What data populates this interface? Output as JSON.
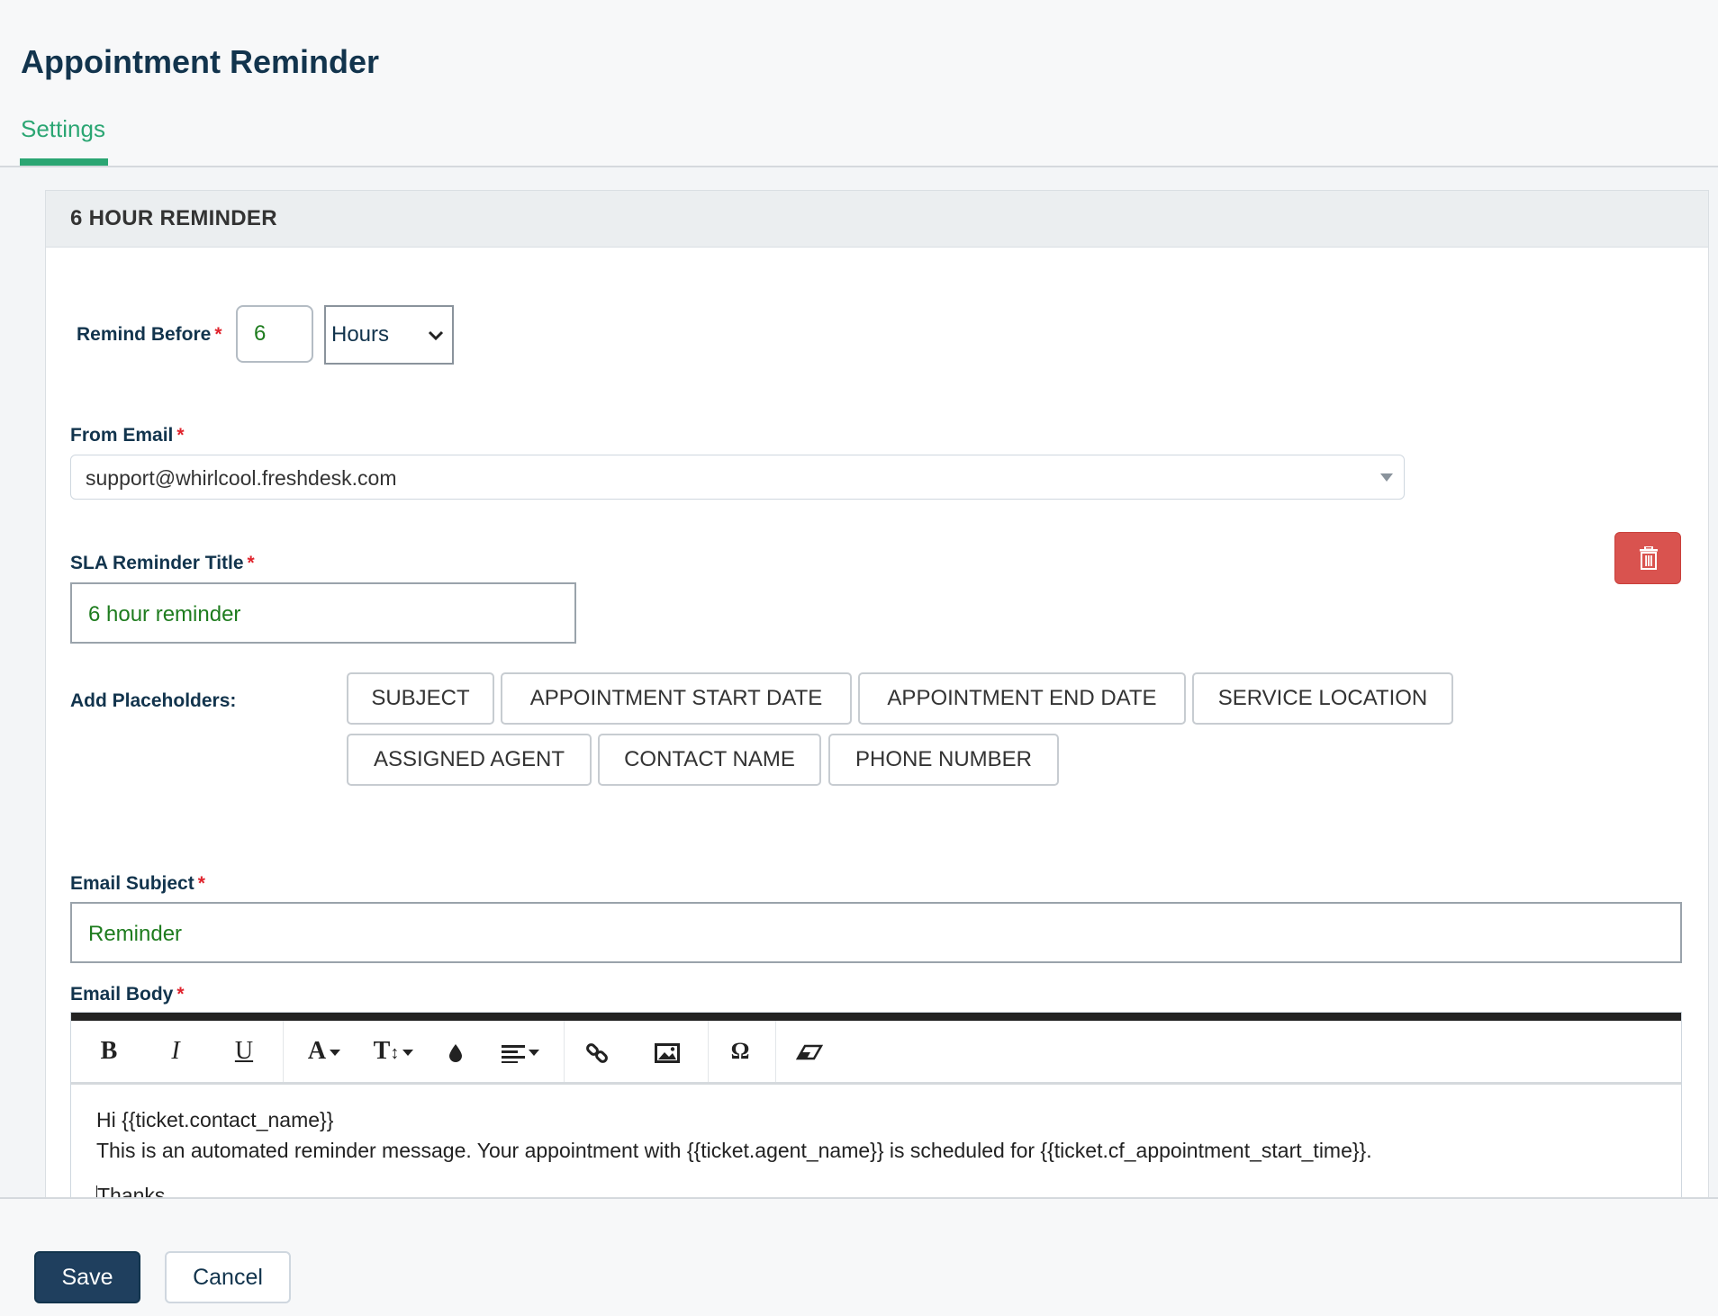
{
  "page": {
    "title": "Appointment Reminder"
  },
  "tabs": [
    {
      "label": "Settings",
      "active": true
    }
  ],
  "panel": {
    "title": "6 HOUR REMINDER"
  },
  "remind_before": {
    "label": "Remind Before",
    "required_mark": "*",
    "value": "6",
    "unit": "Hours"
  },
  "from_email": {
    "label": "From Email",
    "required_mark": "*",
    "value": "support@whirlcool.freshdesk.com"
  },
  "sla_title": {
    "label": "SLA Reminder Title",
    "required_mark": "*",
    "value": "6 hour reminder"
  },
  "placeholders": {
    "label": "Add Placeholders:",
    "buttons": [
      "SUBJECT",
      "APPOINTMENT START DATE",
      "APPOINTMENT END DATE",
      "SERVICE LOCATION",
      "ASSIGNED AGENT",
      "CONTACT NAME",
      "PHONE NUMBER"
    ]
  },
  "email_subject": {
    "label": "Email Subject",
    "required_mark": "*",
    "value": "Reminder"
  },
  "email_body": {
    "label": "Email Body",
    "required_mark": "*",
    "toolbar": [
      "bold",
      "italic",
      "underline",
      "font-family",
      "font-size",
      "text-color",
      "align",
      "link",
      "image",
      "special-character",
      "clear-format"
    ],
    "toolbar_glyphs": {
      "bold": "B",
      "italic": "I",
      "underline": "U",
      "font_family": "A",
      "font_size": "T",
      "special_char": "Ω"
    },
    "lines": [
      "Hi {{ticket.contact_name}}",
      "This is an automated reminder message. Your appointment with {{ticket.agent_name}} is scheduled for {{ticket.cf_appointment_start_time}}.",
      "Thanks,"
    ]
  },
  "footer": {
    "save_label": "Save",
    "cancel_label": "Cancel"
  },
  "colors": {
    "accent": "#2ba673",
    "primary_button": "#1f3f5e",
    "delete_button": "#d9534f",
    "field_text": "#1e7c1e",
    "required": "#e0242d"
  },
  "icons": {
    "delete": "trash-icon",
    "select": "chevron-down-icon"
  }
}
